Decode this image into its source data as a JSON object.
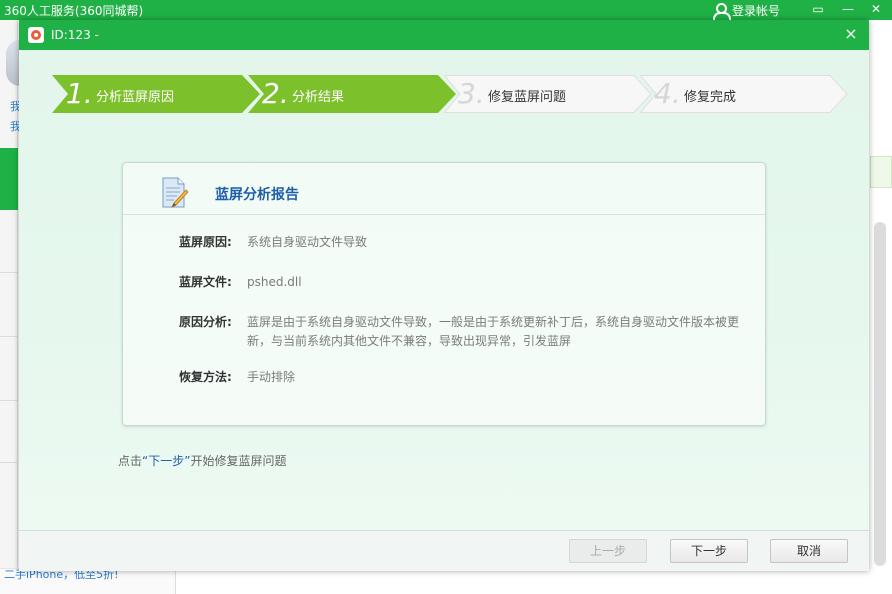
{
  "app": {
    "title": "360人工服务(360同城帮)",
    "login_label": "登录帐号",
    "sidebar_chars": [
      "我",
      "我"
    ],
    "bottom_promo": "二手iPhone，低至5折!"
  },
  "dialog": {
    "title": "ID:123 -",
    "close_symbol": "×"
  },
  "steps": [
    {
      "num": "1.",
      "label": "分析蓝屏原因",
      "state": "active"
    },
    {
      "num": "2.",
      "label": "分析结果",
      "state": "active"
    },
    {
      "num": "3.",
      "label": "修复蓝屏问题",
      "state": "todo"
    },
    {
      "num": "4.",
      "label": "修复完成",
      "state": "todo"
    }
  ],
  "report": {
    "title": "蓝屏分析报告",
    "icon": "document-pencil-icon",
    "rows": [
      {
        "label": "蓝屏原因:",
        "value": "系统自身驱动文件导致"
      },
      {
        "label": "蓝屏文件:",
        "value": "pshed.dll"
      },
      {
        "label": "原因分析:",
        "value": "蓝屏是由于系统自身驱动文件导致，一般是由于系统更新补丁后，系统自身驱动文件版本被更新，与当前系统内其他文件不兼容，导致出现异常，引发蓝屏"
      },
      {
        "label": "恢复方法:",
        "value": "手动排除"
      }
    ]
  },
  "hint": {
    "prefix": "点击",
    "link": "“下一步”",
    "suffix": "开始修复蓝屏问题"
  },
  "buttons": {
    "prev": "上一步",
    "next": "下一步",
    "cancel": "取消"
  },
  "colors": {
    "accent_green": "#1fb145",
    "step_active": "#7cc12c",
    "title_blue": "#1f5fa8"
  }
}
